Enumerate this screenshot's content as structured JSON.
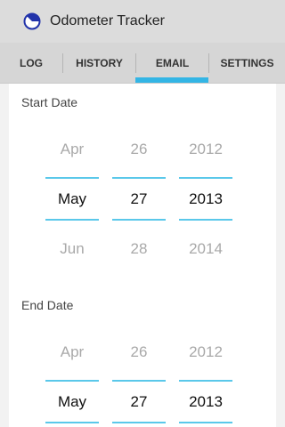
{
  "app": {
    "title": "Odometer Tracker",
    "icon": "clock-pie-icon"
  },
  "tabs": [
    {
      "label": "LOG",
      "selected": false
    },
    {
      "label": "HISTORY",
      "selected": false
    },
    {
      "label": "EMAIL",
      "selected": true
    },
    {
      "label": "SETTINGS",
      "selected": false
    }
  ],
  "start": {
    "label": "Start Date",
    "month": {
      "prev": "Apr",
      "current": "May",
      "next": "Jun"
    },
    "day": {
      "prev": "26",
      "current": "27",
      "next": "28"
    },
    "year": {
      "prev": "2012",
      "current": "2013",
      "next": "2014"
    }
  },
  "end": {
    "label": "End Date",
    "month": {
      "prev": "Apr",
      "current": "May"
    },
    "day": {
      "prev": "26",
      "current": "27"
    },
    "year": {
      "prev": "2012",
      "current": "2013"
    }
  },
  "colors": {
    "accent": "#33b5e5",
    "actionbar": "#dcdcdc",
    "background": "#f2f2f2"
  }
}
